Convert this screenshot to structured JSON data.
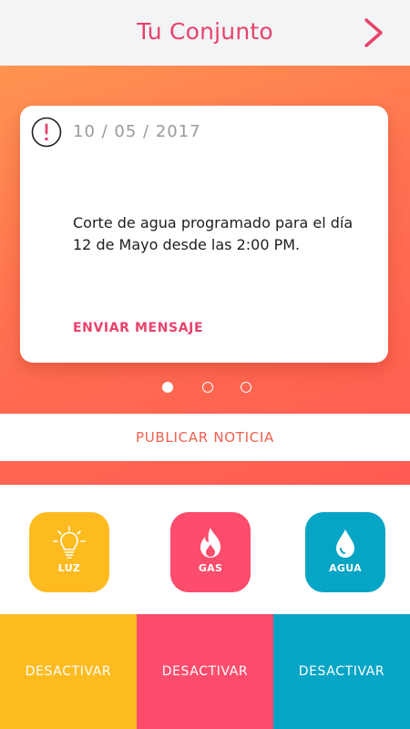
{
  "header": {
    "title": "Tu Conjunto",
    "next_icon": "chevron-right-icon",
    "accent_color": "#e8436c",
    "background_color": "#f3f4f6"
  },
  "notice_card": {
    "icon": "alert-icon",
    "date": "10 / 05 / 2017",
    "message": "Corte de agua programado para el día 12 de Mayo desde las 2:00 PM.",
    "action_label": "ENVIAR MENSAJE"
  },
  "carousel": {
    "pages": 3,
    "active_index": 0
  },
  "publish": {
    "label": "PUBLICAR NOTICIA"
  },
  "utilities": [
    {
      "label": "LUZ",
      "icon": "lightbulb-icon",
      "color": "#fdbb1f"
    },
    {
      "label": "GAS",
      "icon": "flame-icon",
      "color": "#fd4c6c"
    },
    {
      "label": "AGUA",
      "icon": "water-drop-icon",
      "color": "#06a5c6"
    }
  ],
  "deactivate": [
    {
      "label": "DESACTIVAR",
      "color": "#fdbb1f"
    },
    {
      "label": "DESACTIVAR",
      "color": "#fd4c6c"
    },
    {
      "label": "DESACTIVAR",
      "color": "#06a5c6"
    }
  ]
}
